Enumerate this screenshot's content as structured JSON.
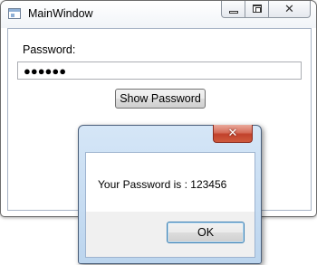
{
  "main_window": {
    "title": "MainWindow",
    "password_label": "Password:",
    "password_masked": "●●●●●●",
    "show_button_label": "Show Password",
    "icons": {
      "app": "app-window-icon",
      "minimize": "minimize-icon",
      "maximize": "maximize-icon",
      "close": "close-icon"
    },
    "close_glyph": "✕"
  },
  "message_box": {
    "text": "Your Password is : 123456",
    "ok_label": "OK",
    "close_glyph": "✕",
    "icons": {
      "close": "close-icon"
    }
  },
  "colors": {
    "titlebar": "#f1f4f8",
    "messagebox_frame": "#bcd5ee",
    "close_button_red": "#c1412b"
  }
}
